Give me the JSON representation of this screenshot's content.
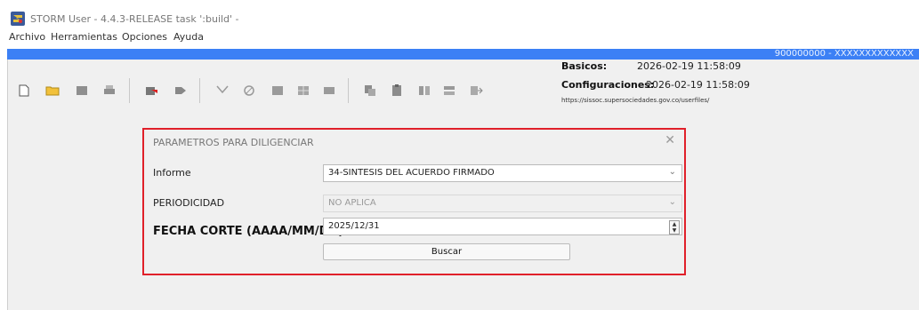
{
  "window": {
    "title": "STORM User - 4.4.3-RELEASE  task ':build' -"
  },
  "menu": [
    "Archivo",
    "Herramientas",
    "Opciones",
    "Ayuda"
  ],
  "user_bar": {
    "label": "900000000 - XXXXXXXXXXXXX",
    "color": "#3c80f5"
  },
  "toolbar": {
    "icons": [
      "new-document-icon",
      "open-folder-icon",
      "save-icon",
      "print-icon",
      "import-icon",
      "forward-icon",
      "filter-icon",
      "validate-icon",
      "table-icon",
      "grid-icon",
      "block-icon",
      "copy-icon",
      "paste-icon",
      "merge-icon",
      "split-icon",
      "export-icon"
    ]
  },
  "info": {
    "basicos_label": "Basicos:",
    "basicos_value": "2026-02-19 11:58:09",
    "config_label": "Configuraciones:",
    "config_value": "2026-02-19 11:58:09",
    "url": "https://sissoc.supersociedades.gov.co/userfiles/"
  },
  "dialog": {
    "title": "PARAMETROS PARA DILIGENCIAR",
    "close": "✕",
    "informe_label": "Informe",
    "informe_value": "34-SINTESIS DEL ACUERDO FIRMADO",
    "periodicidad_label": "PERIODICIDAD",
    "periodicidad_value": "NO APLICA",
    "fecha_label": "FECHA CORTE (AAAA/MM/DD)",
    "fecha_value": "2025/12/31",
    "buscar_label": "Buscar",
    "highlight_color": "#e0202a"
  }
}
